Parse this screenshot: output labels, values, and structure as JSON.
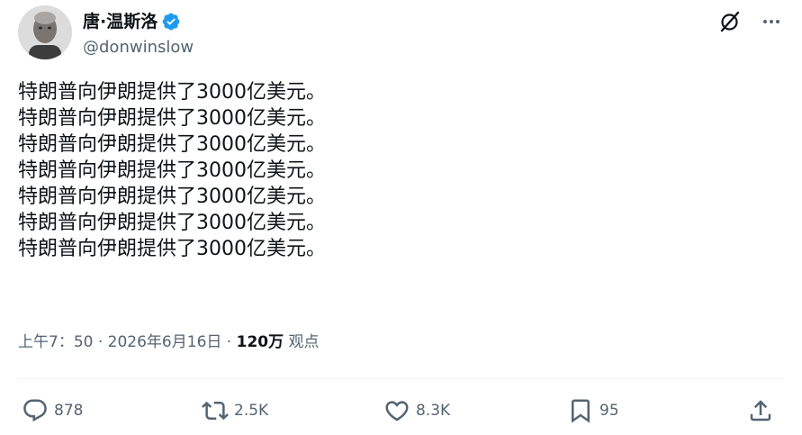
{
  "author": {
    "display_name": "唐·温斯洛",
    "handle": "@donwinslow",
    "verified": true
  },
  "tweet": {
    "lines": [
      "特朗普向伊朗提供了3000亿美元。",
      "特朗普向伊朗提供了3000亿美元。",
      "特朗普向伊朗提供了3000亿美元。",
      "特朗普向伊朗提供了3000亿美元。",
      "特朗普向伊朗提供了3000亿美元。",
      "特朗普向伊朗提供了3000亿美元。",
      "特朗普向伊朗提供了3000亿美元。"
    ]
  },
  "meta": {
    "time": "上午7：50",
    "separator": " · ",
    "date": "2026年6月16日",
    "views_count": "120万",
    "views_label": "观点"
  },
  "actions": {
    "replies": "878",
    "reposts": "2.5K",
    "likes": "8.3K",
    "bookmarks": "95"
  },
  "icons": {
    "header": [
      "grok-icon",
      "more-icon"
    ],
    "actions": [
      "reply-icon",
      "repost-icon",
      "like-icon",
      "bookmark-icon",
      "share-icon"
    ]
  },
  "colors": {
    "text": "#0f1419",
    "secondary": "#536471",
    "verified": "#1d9bf0",
    "divider": "#eff3f4"
  }
}
